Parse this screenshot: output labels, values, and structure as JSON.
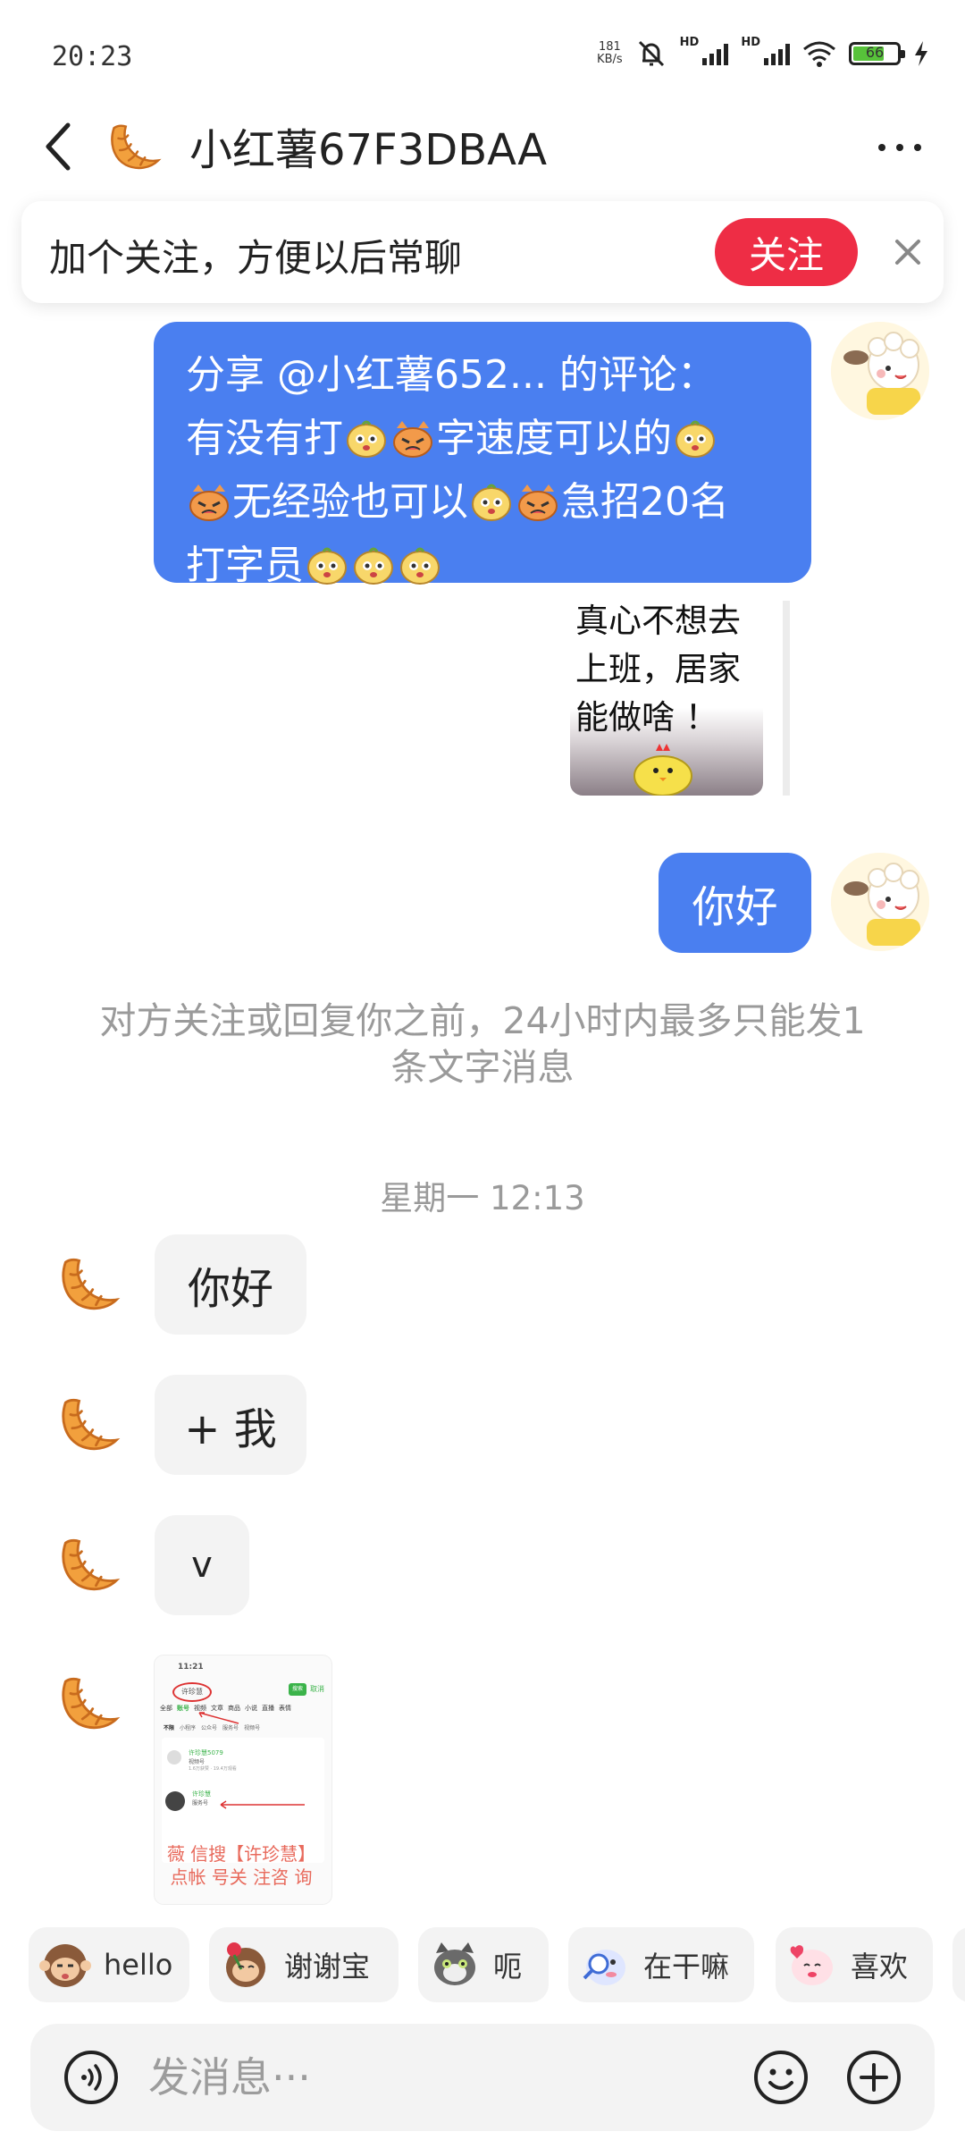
{
  "status_bar": {
    "time": "20:23",
    "net_speed_top": "181",
    "net_speed_bottom": "KB/s",
    "hd1": "HD",
    "hd2": "HD",
    "battery_level": "66",
    "icons": [
      "mute-bell-icon",
      "signal-icon",
      "signal-icon",
      "wifi-icon",
      "battery-icon",
      "charging-bolt-icon"
    ]
  },
  "header": {
    "title": "小红薯67F3DBAA",
    "icons": [
      "back-chevron-icon",
      "croissant-avatar-icon",
      "more-dots-icon"
    ]
  },
  "follow_banner": {
    "text": "加个关注，方便以后常聊",
    "button_label": "关注"
  },
  "messages": {
    "share": {
      "line1": "分享 @小红薯652... 的评论：",
      "seg1": "有没有打",
      "seg2": "字速度可以的",
      "seg3": "无经验也可以",
      "seg4": "急招20名",
      "seg5": "打字员"
    },
    "share_card": {
      "text": "真心不想去上班，居家能做啥 ！"
    },
    "hello_out": "你好",
    "system_note": "对方关注或回复你之前，24小时内最多只能发1条文字消息",
    "timestamp": "星期一 12:13",
    "incoming": [
      "你好",
      "+ 我",
      "v"
    ],
    "image_caption": "薇 信搜【许珍慧】\n点帐 号关 注咨 询",
    "image_shot": {
      "time": "11:21",
      "search": "许珍慧",
      "search_btn": "搜索",
      "cancel": "取消",
      "tabs": [
        "全部",
        "账号",
        "视频",
        "文章",
        "商品",
        "小说",
        "直播",
        "表情"
      ],
      "subtabs": [
        "不限",
        "小程序",
        "公众号",
        "服务号",
        "视频号"
      ],
      "r1_title": "许珍慧5079",
      "r1_sub": "视频号",
      "r1_meta": "1.6万获赞 · 19.4万观看",
      "r2_title": "许珍慧",
      "r2_sub": "服务号"
    }
  },
  "quick_replies": [
    "hello",
    "谢谢宝",
    "呃",
    "在干嘛",
    "喜欢"
  ],
  "input": {
    "placeholder": "发消息···"
  },
  "colors": {
    "accent_red": "#ee2d45",
    "bubble_blue": "#4a7ff0",
    "bubble_gray": "#f3f3f3",
    "croissant": "#f2a03d"
  }
}
